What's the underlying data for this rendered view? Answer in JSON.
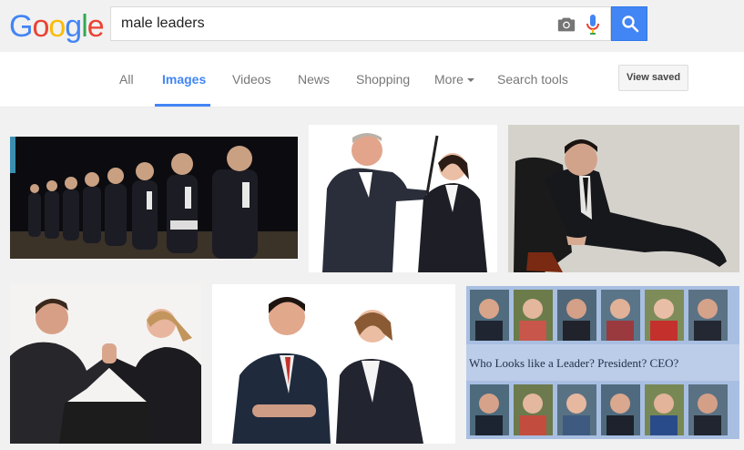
{
  "logo": {
    "text": "Google"
  },
  "search": {
    "query": "male leaders"
  },
  "tabs": [
    {
      "label": "All"
    },
    {
      "label": "Images"
    },
    {
      "label": "Videos"
    },
    {
      "label": "News"
    },
    {
      "label": "Shopping"
    },
    {
      "label": "More"
    },
    {
      "label": "Search tools"
    }
  ],
  "view_saved_label": "View saved",
  "results": {
    "composite_caption": "Who Looks like a Leader? President? CEO?"
  },
  "colors": {
    "accent": "#4285f4",
    "page_bg": "#f1f1f1"
  }
}
